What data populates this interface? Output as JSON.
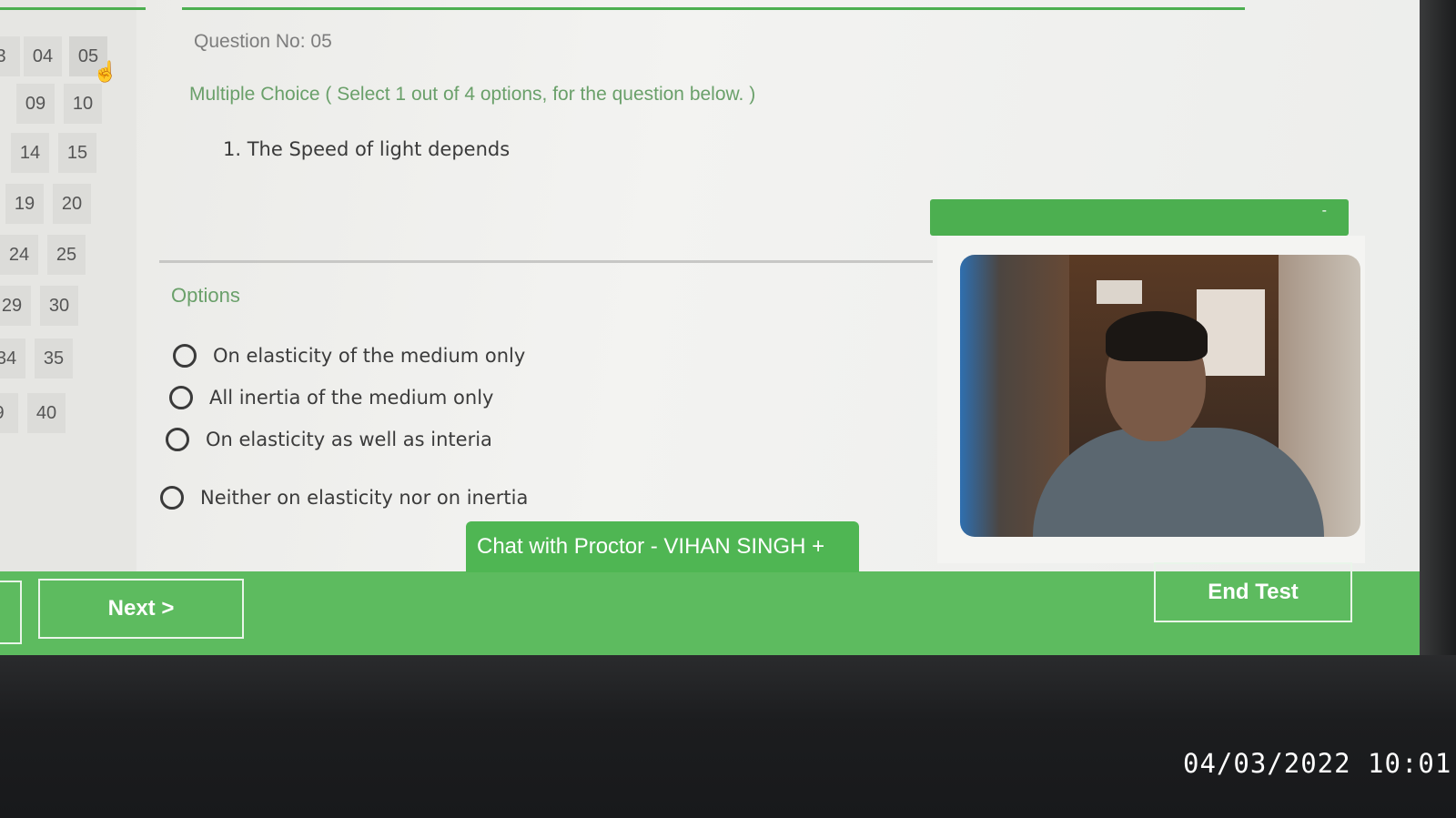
{
  "navigator": {
    "questions": [
      "3",
      "04",
      "05",
      "09",
      "10",
      "14",
      "15",
      "19",
      "20",
      "24",
      "25",
      "29",
      "30",
      "34",
      "35",
      "9",
      "40"
    ],
    "active": "05"
  },
  "question": {
    "number_label": "Question No: 05",
    "type_label": "Multiple Choice ( Select 1 out of 4 options, for the question below. )",
    "text": "1. The Speed of light depends"
  },
  "options": {
    "title": "Options",
    "items": [
      "On elasticity of the medium only",
      "All inertia of the medium only",
      "On elasticity as well as interia",
      "Neither on elasticity nor on inertia"
    ]
  },
  "proctor": {
    "minimize_symbol": "-",
    "chat_label": "Chat with Proctor - VIHAN SINGH  +"
  },
  "footer": {
    "next_label": "Next >",
    "end_label": "End Test"
  },
  "photo_timestamp": "04/03/2022 10:01",
  "colors": {
    "accent_green": "#4caf50",
    "bar_green": "#5dbb5f"
  }
}
